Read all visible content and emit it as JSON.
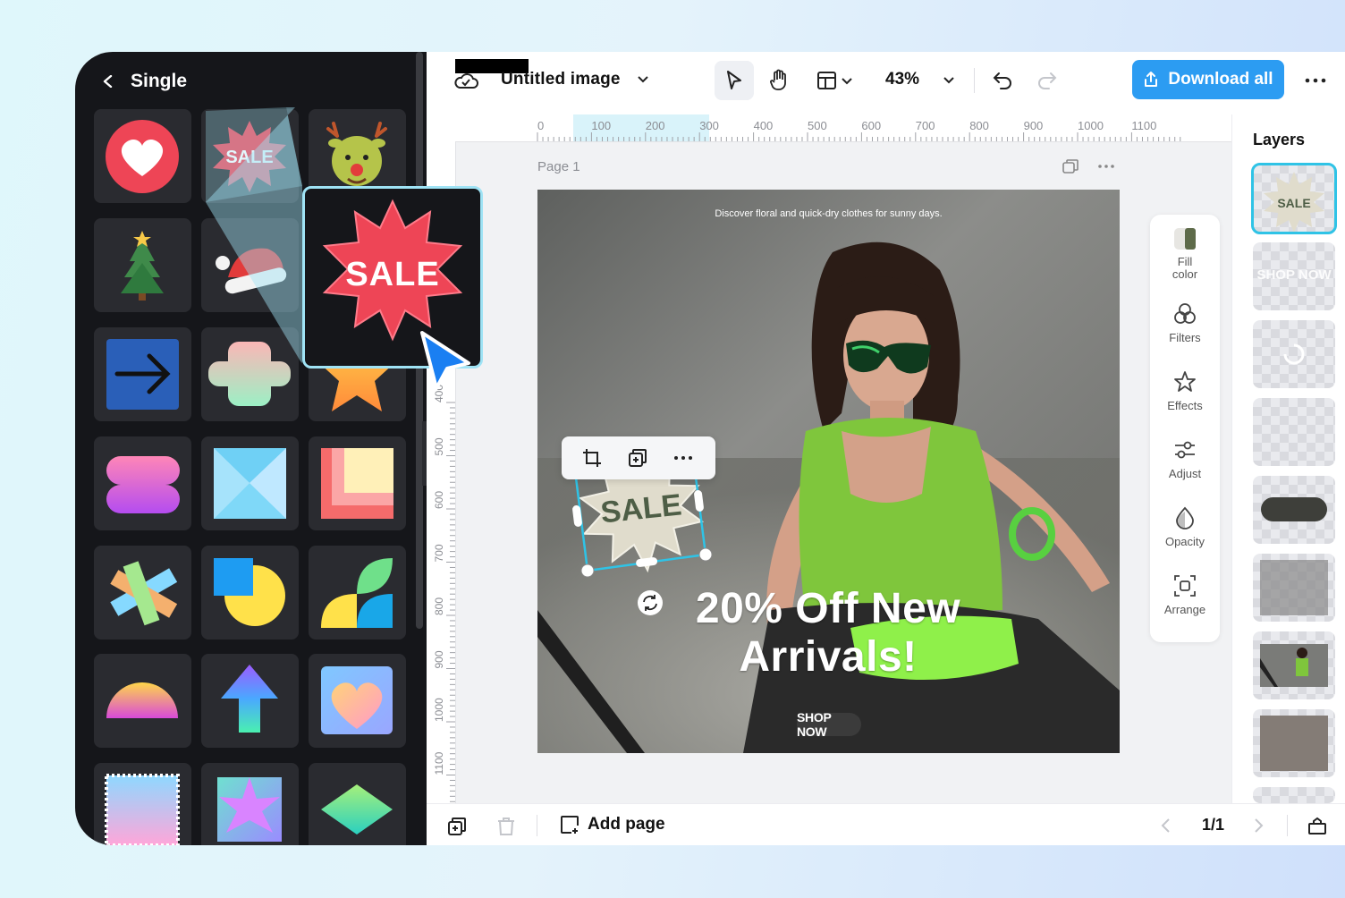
{
  "panel": {
    "title": "Single",
    "stickers": [
      {
        "name": "heart-sticker"
      },
      {
        "name": "sale-sticker",
        "label": "SALE"
      },
      {
        "name": "reindeer-sticker"
      },
      {
        "name": "christmas-tree-sticker"
      },
      {
        "name": "santa-hat-sticker"
      },
      {
        "name": "blank-sticker"
      },
      {
        "name": "arrow-right-sticker"
      },
      {
        "name": "flower-cross-sticker"
      },
      {
        "name": "star-sticker"
      },
      {
        "name": "pink-pill-sticker"
      },
      {
        "name": "envelope-sticker"
      },
      {
        "name": "square-frames-sticker"
      },
      {
        "name": "cross-stripes-sticker"
      },
      {
        "name": "circle-square-sticker"
      },
      {
        "name": "leaf-shapes-sticker"
      },
      {
        "name": "half-circle-sticker"
      },
      {
        "name": "arrow-up-sticker"
      },
      {
        "name": "heart-card-sticker"
      },
      {
        "name": "stamp-sticker"
      },
      {
        "name": "star-burst-sticker"
      },
      {
        "name": "diamond-sticker"
      }
    ],
    "preview_label": "SALE"
  },
  "topbar": {
    "doc_title": "Untitled image",
    "zoom": "43%",
    "download_label": "Download all"
  },
  "ruler": {
    "h_ticks": [
      "0",
      "100",
      "200",
      "300",
      "400",
      "500",
      "600",
      "700",
      "800",
      "900",
      "1000",
      "1100"
    ],
    "v_ticks": [
      "400",
      "500",
      "600",
      "700",
      "800",
      "900",
      "1000",
      "1100"
    ]
  },
  "canvas": {
    "page_label": "Page 1",
    "tagline": "Discover floral and quick-dry clothes for sunny days.",
    "headline_line1": "20% Off New",
    "headline_line2": "Arrivals!",
    "shop_now": "SHOP NOW",
    "sale_label": "SALE"
  },
  "tools": [
    {
      "label": "Fill color",
      "icon": "fill-color-icon"
    },
    {
      "label": "Filters",
      "icon": "filters-icon"
    },
    {
      "label": "Effects",
      "icon": "effects-icon"
    },
    {
      "label": "Adjust",
      "icon": "adjust-icon"
    },
    {
      "label": "Opacity",
      "icon": "opacity-icon"
    },
    {
      "label": "Arrange",
      "icon": "arrange-icon"
    }
  ],
  "layers": {
    "title": "Layers",
    "sale_thumb": "SALE",
    "shop_thumb": "SHOP NOW"
  },
  "bottom": {
    "add_page": "Add page",
    "pager": "1/1"
  },
  "colors": {
    "accent": "#2c9cf2",
    "selection": "#2fc3e6",
    "sale_red": "#ee4556",
    "panel_bg": "#15161a"
  }
}
